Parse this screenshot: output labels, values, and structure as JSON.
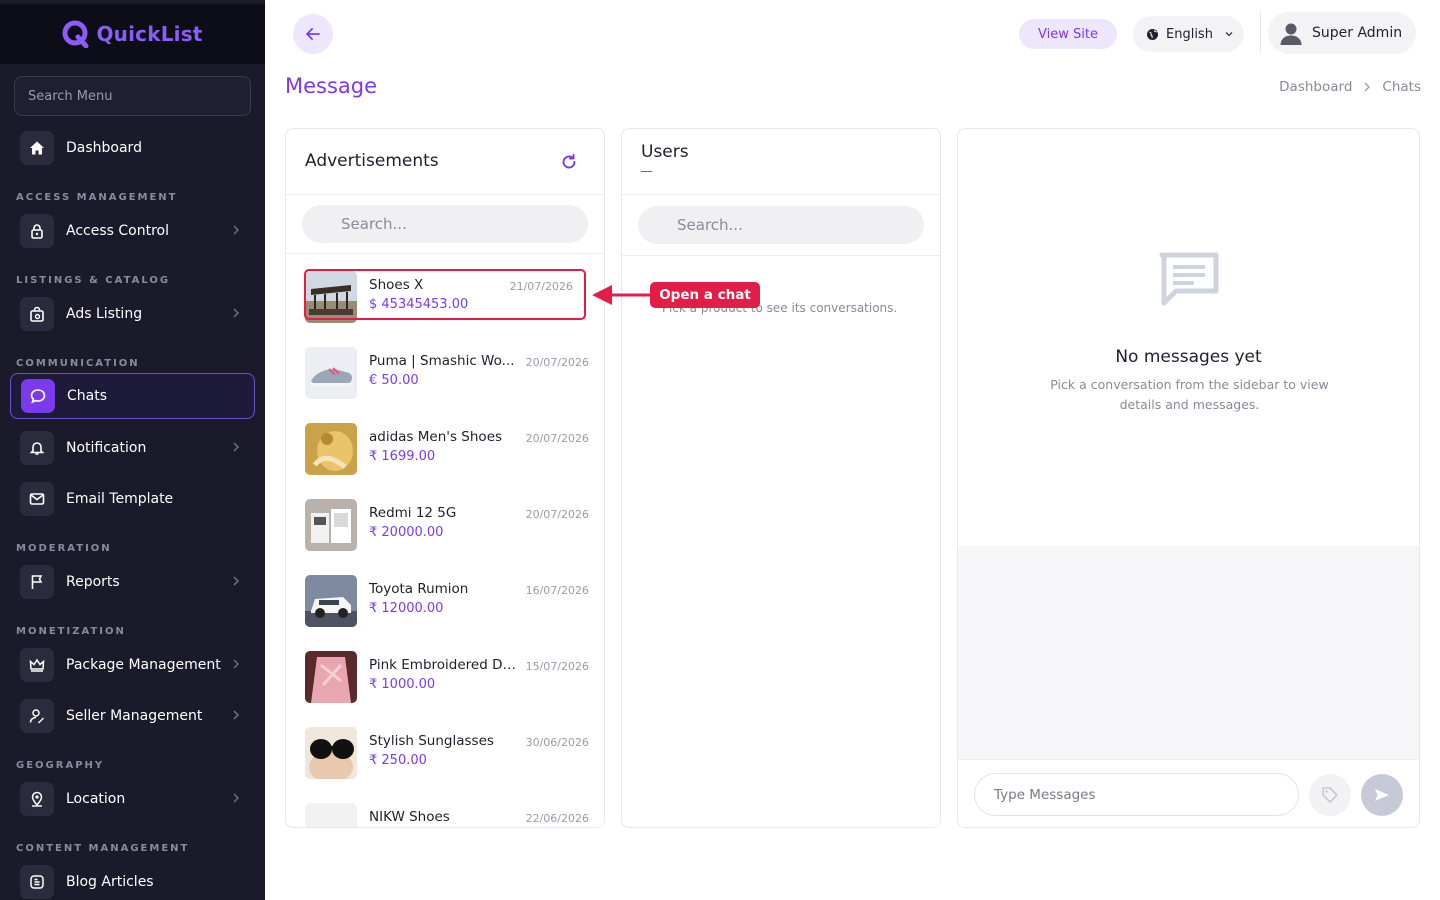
{
  "app": {
    "name": "QuickList"
  },
  "sidebar": {
    "search_placeholder": "Search Menu",
    "sections": {
      "access": "ACCESS MANAGEMENT",
      "listings": "LISTINGS & CATALOG",
      "communication": "COMMUNICATION",
      "moderation": "MODERATION",
      "monetization": "MONETIZATION",
      "geography": "GEOGRAPHY",
      "content": "CONTENT MANAGEMENT"
    },
    "items": {
      "dashboard": "Dashboard",
      "access_control": "Access Control",
      "ads_listing": "Ads Listing",
      "chats": "Chats",
      "notification": "Notification",
      "email_template": "Email Template",
      "reports": "Reports",
      "package_management": "Package Management",
      "seller_management": "Seller Management",
      "location": "Location",
      "blog_articles": "Blog Articles"
    },
    "active_item": "Chats"
  },
  "header": {
    "view_site": "View Site",
    "language": "English",
    "user_name": "Super Admin"
  },
  "page": {
    "title": "Message",
    "breadcrumb": [
      "Dashboard",
      "Chats"
    ]
  },
  "advertisements": {
    "title": "Advertisements",
    "search_placeholder": "Search...",
    "items": [
      {
        "name": "Shoes X",
        "price": "$ 45345453.00",
        "date": "21/07/2026"
      },
      {
        "name": "Puma | Smashic Wo...",
        "price": "€ 50.00",
        "date": "20/07/2026"
      },
      {
        "name": "adidas Men's Shoes",
        "price": "₹ 1699.00",
        "date": "20/07/2026"
      },
      {
        "name": "Redmi 12 5G",
        "price": "₹ 20000.00",
        "date": "20/07/2026"
      },
      {
        "name": "Toyota Rumion",
        "price": "₹ 12000.00",
        "date": "16/07/2026"
      },
      {
        "name": "Pink Embroidered Do...",
        "price": "₹ 1000.00",
        "date": "15/07/2026"
      },
      {
        "name": "Stylish Sunglasses",
        "price": "₹ 250.00",
        "date": "30/06/2026"
      },
      {
        "name": "NIKW Shoes",
        "price": "",
        "date": "22/06/2026"
      }
    ]
  },
  "users": {
    "title": "Users",
    "search_placeholder": "Search...",
    "hint": "Pick a product to see its conversations."
  },
  "chat": {
    "empty_title": "No messages yet",
    "empty_desc": "Pick a conversation from the sidebar to view details and messages.",
    "input_placeholder": "Type Messages"
  },
  "annotation": {
    "label": "Open a chat"
  },
  "colors": {
    "accent": "#7c3aed",
    "sidebar_bg": "#1a1a2b",
    "annotation": "#e11d48"
  }
}
